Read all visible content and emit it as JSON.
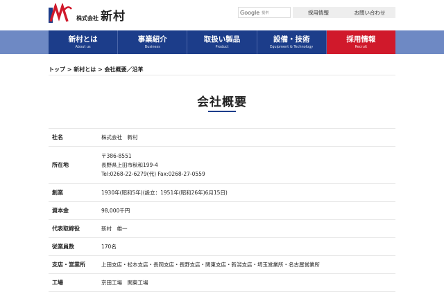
{
  "header": {
    "company_prefix": "株式会社",
    "company_name": "新村",
    "search": {
      "brand": "Google",
      "label": "提供"
    },
    "recruit_label": "採用情報",
    "contact_label": "お問い合わせ"
  },
  "nav": [
    {
      "jp": "新村とは",
      "en": "About us"
    },
    {
      "jp": "事業紹介",
      "en": "Business"
    },
    {
      "jp": "取扱い製品",
      "en": "Product"
    },
    {
      "jp": "設備・技術",
      "en": "Equipment & Technology"
    },
    {
      "jp": "採用情報",
      "en": "Recruit"
    }
  ],
  "breadcrumb": "トップ > 新村とは > 会社概要／沿革",
  "page_title": "会社概要",
  "profile": [
    {
      "label": "社名",
      "lines": [
        "株式会社　新村"
      ]
    },
    {
      "label": "所在地",
      "lines": [
        "〒386-8551",
        "長野県上田市秋和199-4",
        "Tel:0268-22-6279(代) Fax:0268-27-0559"
      ]
    },
    {
      "label": "創業",
      "lines": [
        "1930年(昭和5年)(設立：1951年(昭和26年)6月15日)"
      ]
    },
    {
      "label": "資本金",
      "lines": [
        "98,000千円"
      ]
    },
    {
      "label": "代表取締役",
      "lines": [
        "新村　雄一"
      ]
    },
    {
      "label": "従業員数",
      "lines": [
        "170名"
      ]
    },
    {
      "label": "支店・営業所",
      "lines": [
        "上田支店・松本支店・長岡支店・長野支店・関東支店・新潟支店・埼玉営業所・名古屋営業所"
      ]
    },
    {
      "label": "工場",
      "lines": [
        "京田工場　関東工場"
      ]
    }
  ],
  "colors": {
    "navy": "#1c3d8a",
    "red": "#d0192b",
    "light_blue": "#6e89c4"
  }
}
